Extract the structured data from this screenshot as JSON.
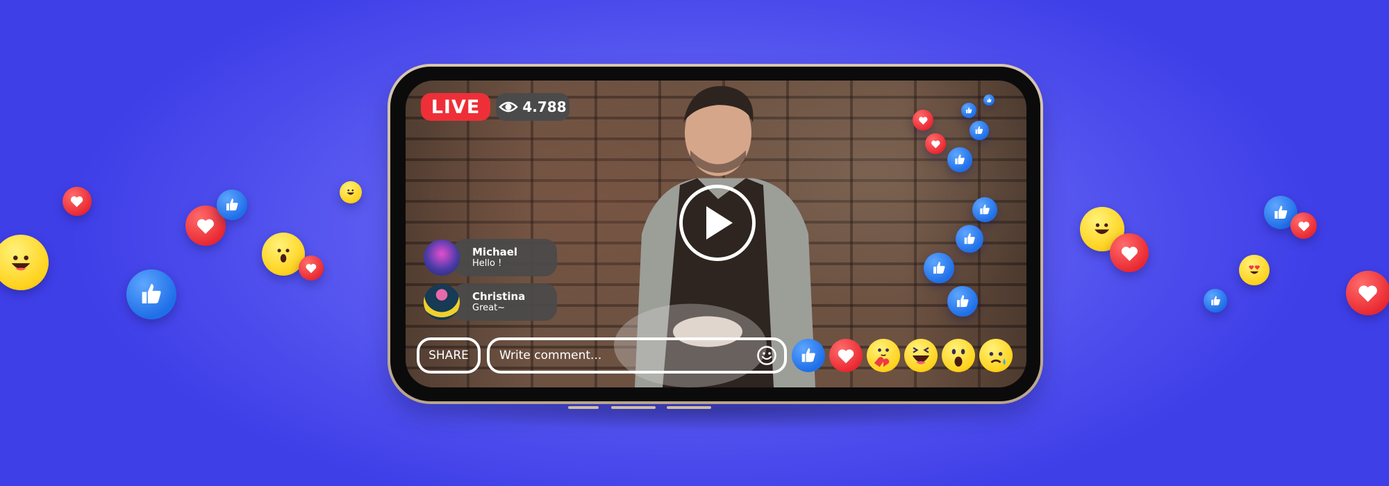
{
  "stream": {
    "live_label": "LIVE",
    "viewer_count": "4.788",
    "viewer_icon": "eye-icon"
  },
  "comments": [
    {
      "name": "Michael",
      "message": "Hello !",
      "avatar": "city-neon-avatar"
    },
    {
      "name": "Christina",
      "message": "Great~",
      "avatar": "woman-pink-hat-avatar"
    }
  ],
  "actions": {
    "share_label": "SHARE",
    "comment_placeholder": "Write comment...",
    "emoji_icon": "smiley-icon"
  },
  "reactions": [
    {
      "name": "like",
      "icon": "thumbs-up-icon"
    },
    {
      "name": "love",
      "icon": "heart-icon"
    },
    {
      "name": "care",
      "icon": "hug-emoji-icon"
    },
    {
      "name": "haha",
      "icon": "laughing-emoji-icon"
    },
    {
      "name": "wow",
      "icon": "surprised-emoji-icon"
    },
    {
      "name": "sad",
      "icon": "crying-emoji-icon"
    }
  ],
  "player": {
    "play_icon": "play-icon"
  },
  "colors": {
    "live_red": "#ee2f38",
    "like_blue": "#1f6fe8",
    "love_red": "#e8262f",
    "emoji_yellow": "#ffd21c",
    "background_blue": "#5f5ff2"
  }
}
